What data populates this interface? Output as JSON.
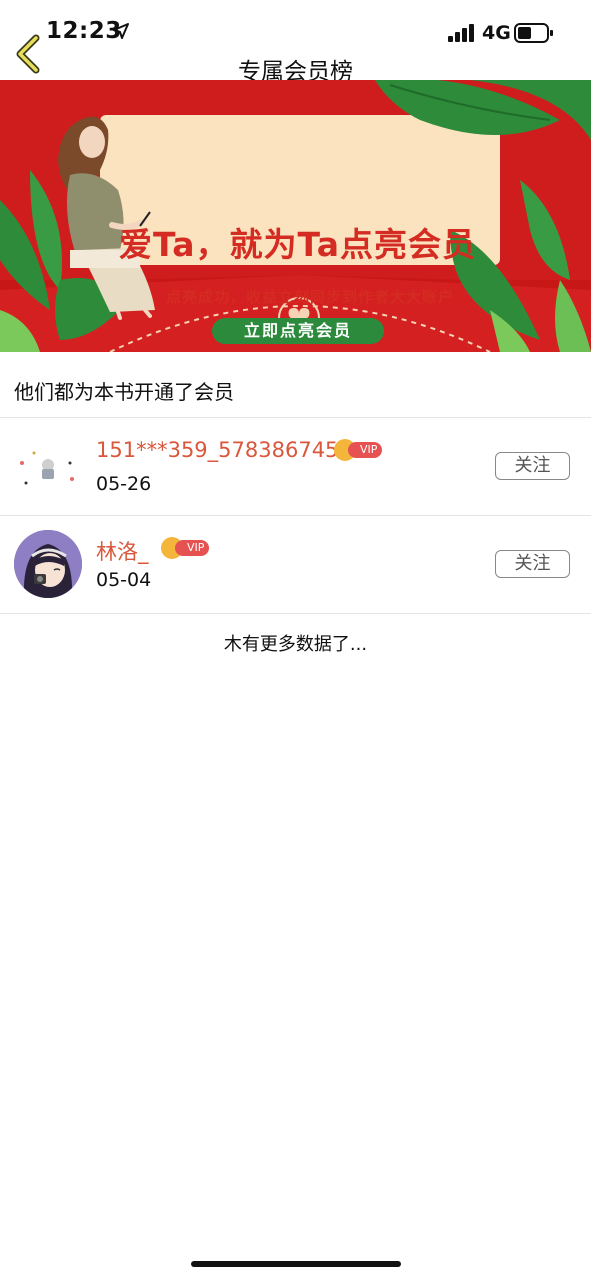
{
  "status_bar": {
    "time": "12:23",
    "network": "4G",
    "icons": [
      "location-arrow-icon",
      "signal-bars-icon",
      "battery-icon"
    ]
  },
  "nav": {
    "back_icon": "chevron-left-icon",
    "title": "专属会员榜"
  },
  "banner": {
    "headline": "爱Ta，就为Ta点亮会员",
    "subtitle": "点亮成功，收益立刻同步到作者大大账户",
    "cta_label": "立即点亮会员",
    "colors": {
      "background": "#cf1d1d",
      "card": "#fbe3c0",
      "cta": "#2c8a3c",
      "text": "#d42b22"
    }
  },
  "members_section": {
    "heading": "他们都为本书开通了会员",
    "members": [
      {
        "name": "151***359_578386745",
        "badge": "VIP",
        "date": "05-26",
        "follow_label": "关注"
      },
      {
        "name": "林洛_",
        "badge": "VIP",
        "date": "05-04",
        "follow_label": "关注"
      }
    ]
  },
  "footer": {
    "no_more_text": "木有更多数据了..."
  },
  "colors": {
    "name_accent": "#d9573b",
    "vip_pill": "#e65252",
    "vip_crown": "#f3b63b"
  }
}
